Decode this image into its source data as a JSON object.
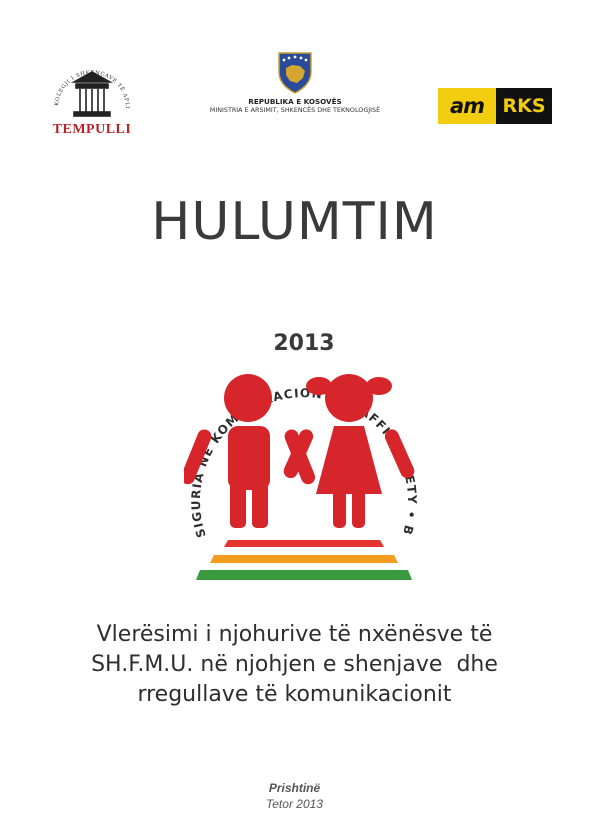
{
  "logos": {
    "tempulli": {
      "name": "TEMPULLI",
      "arc_text": "KOLEGJI I SHKENCAVE TË APLIKUARA TEKNIKE",
      "color": "#b8232a"
    },
    "kosovo_ministry": {
      "line1": "REPUBLIKA E KOSOVËS",
      "line2": "MINISTRIA E ARSIMIT, SHKENCËS DHE TEKNOLOGJISË",
      "shield_color": "#2a4a9a",
      "stars_color": "#ffffff",
      "map_color": "#d4a630"
    },
    "amrks": {
      "left_text": "am",
      "right_text": "RKS",
      "yellow": "#f2cc0f",
      "black": "#111111"
    }
  },
  "title": "HULUMTIM",
  "emblem": {
    "arc_text": "SIGURIA NË KOMUNIKACION • TRAFFIC SAFETY • BEZBEDNOSTI U SAOBRAĆAJU",
    "year": "2013",
    "figure_color": "#d7262b",
    "stripe_colors": [
      "#e3342f",
      "#f39c1f",
      "#3a9a3f"
    ]
  },
  "subtitle": {
    "line1": "Vlerësimi i njohurive të nxënësve të",
    "line2": "SH.F.M.U. në njohjen e shenjave  dhe",
    "line3": "rregullave të komunikacionit"
  },
  "footer": {
    "city": "Prishtinë",
    "date": "Tetor 2013"
  }
}
